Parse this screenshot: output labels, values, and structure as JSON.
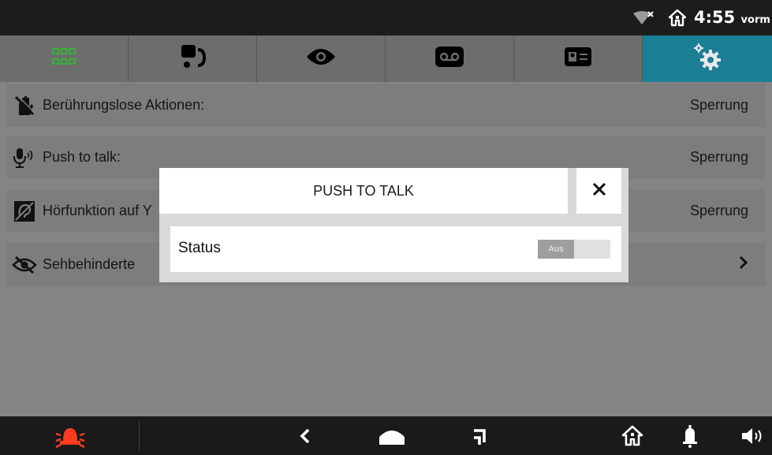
{
  "status_bar": {
    "time": "4:55",
    "time_suffix": "vorm",
    "icons": [
      "wifi-off-icon",
      "home-icon"
    ]
  },
  "tabs": [
    {
      "name": "apps",
      "icon": "grid-icon"
    },
    {
      "name": "intercom",
      "icon": "intercom-icon"
    },
    {
      "name": "surveillance",
      "icon": "eye-icon"
    },
    {
      "name": "voicemail",
      "icon": "voicemail-icon"
    },
    {
      "name": "contacts",
      "icon": "contact-card-icon"
    },
    {
      "name": "settings",
      "icon": "gear-icon",
      "active": true
    }
  ],
  "settings_rows": [
    {
      "icon": "hand-off-icon",
      "label": "Berührungslose Aktionen:",
      "value": "Sperrung"
    },
    {
      "icon": "microphone-icon",
      "label": "Push to talk:",
      "value": "Sperrung"
    },
    {
      "icon": "hearing-icon",
      "label": "Hörfunktion auf Y",
      "value": "Sperrung"
    },
    {
      "icon": "eye-off-icon",
      "label": "Sehbehinderte",
      "value": ""
    }
  ],
  "dialog": {
    "title": "PUSH TO TALK",
    "status_label": "Status",
    "toggle_value": "Aus"
  },
  "nav_bar": {
    "icons": [
      "alarm-icon",
      "back-icon",
      "home-icon",
      "recent-icon",
      "house-icon",
      "bell-icon",
      "speaker-icon"
    ]
  },
  "colors": {
    "accent": "#1a7f95",
    "alarm": "#ff3b1f",
    "grid": "#35b335"
  }
}
